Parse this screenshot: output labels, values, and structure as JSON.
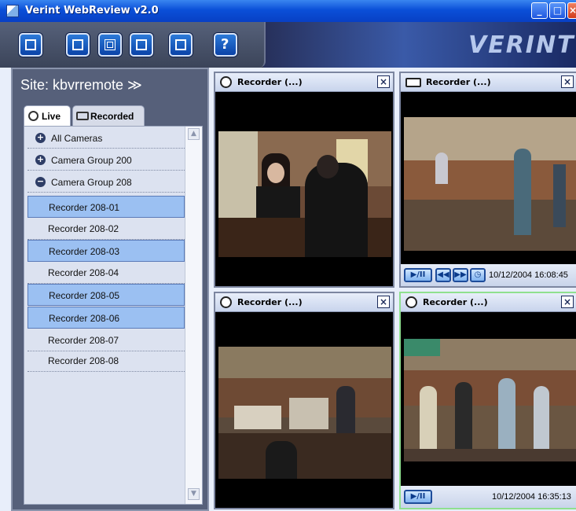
{
  "window": {
    "title": "Verint WebReview v2.0"
  },
  "toolbar": {
    "buttons": [
      "back-icon",
      "single-view-icon",
      "quad-view-icon",
      "multi-view-icon",
      "fullscreen-icon",
      "help-icon"
    ],
    "help_glyph": "?",
    "logo_text": "VERINT"
  },
  "sidebar": {
    "site_label": "Site: kbvrremote ≫",
    "tabs": {
      "live": "Live",
      "recorded": "Recorded"
    },
    "tree": {
      "groups": [
        "All Cameras",
        "Camera Group 200",
        "Camera Group 208"
      ],
      "recorders": [
        {
          "label": "Recorder 208-01",
          "selected": true
        },
        {
          "label": "Recorder 208-02",
          "selected": false
        },
        {
          "label": "Recorder 208-03",
          "selected": true
        },
        {
          "label": "Recorder 208-04",
          "selected": false
        },
        {
          "label": "Recorder 208-05",
          "selected": true
        },
        {
          "label": "Recorder 208-06",
          "selected": true
        },
        {
          "label": "Recorder 208-07",
          "selected": false
        },
        {
          "label": "Recorder 208-08",
          "selected": false
        }
      ]
    }
  },
  "panes": [
    {
      "name": "Recorder  (...)",
      "mode": "live"
    },
    {
      "name": "Recorder  (...)",
      "mode": "recorded",
      "timestamp": "10/12/2004  16:08:45"
    },
    {
      "name": "Recorder  (...)",
      "mode": "live"
    },
    {
      "name": "Recorder  (...)",
      "mode": "recorded",
      "timestamp": "10/12/2004  16:35:13"
    }
  ],
  "colors": {
    "selection": "#9bc0f2",
    "title_bar": "#0a4fd8",
    "active_pane_border": "#8fe08f"
  }
}
